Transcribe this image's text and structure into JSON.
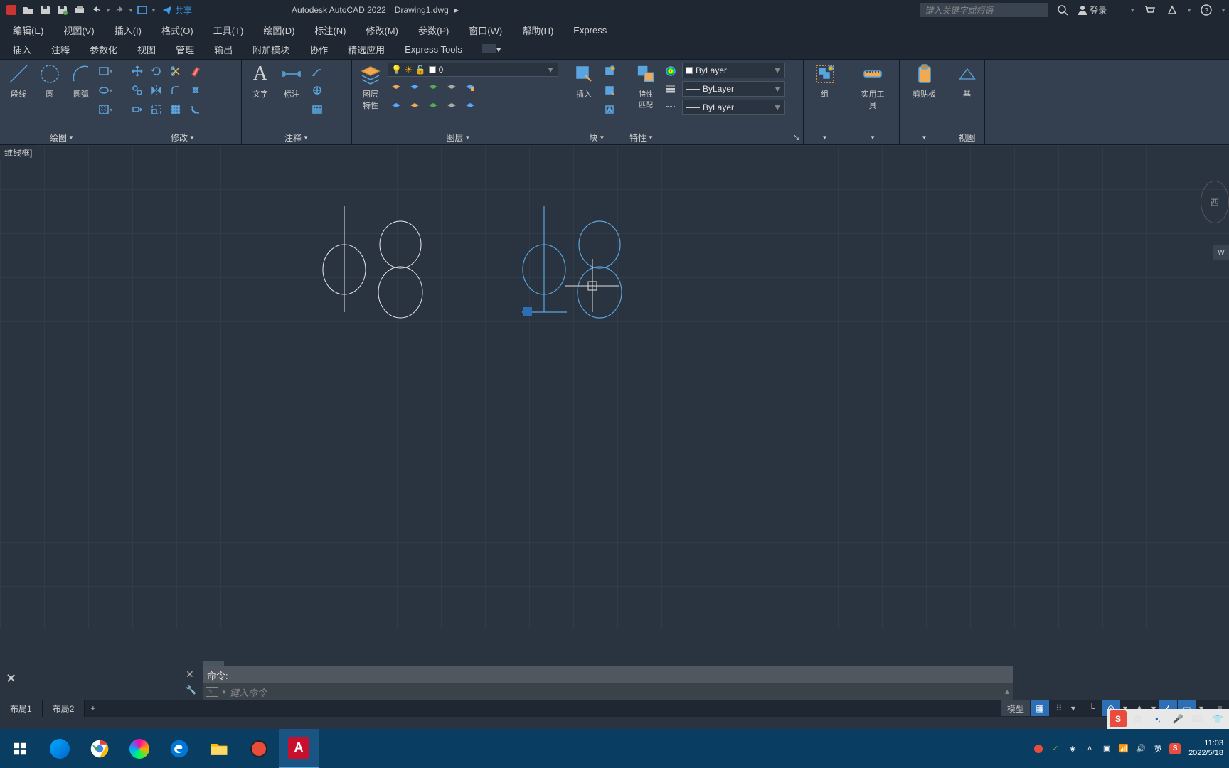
{
  "titlebar": {
    "app_name": "Autodesk AutoCAD 2022",
    "file_name": "Drawing1.dwg",
    "share_label": "共享",
    "search_placeholder": "键入关键字或短语",
    "login_label": "登录"
  },
  "menubar": {
    "items": [
      "编辑(E)",
      "视图(V)",
      "插入(I)",
      "格式(O)",
      "工具(T)",
      "绘图(D)",
      "标注(N)",
      "修改(M)",
      "参数(P)",
      "窗口(W)",
      "帮助(H)",
      "Express"
    ]
  },
  "ribbon_tabs": [
    "插入",
    "注释",
    "参数化",
    "视图",
    "管理",
    "输出",
    "附加模块",
    "协作",
    "精选应用",
    "Express Tools"
  ],
  "panels": {
    "draw": {
      "title": "绘图",
      "tools": {
        "line": "段线",
        "circle": "圆",
        "arc": "圆弧"
      }
    },
    "modify": {
      "title": "修改"
    },
    "annotation": {
      "title": "注释",
      "tools": {
        "text": "文字",
        "dim": "标注"
      }
    },
    "layers": {
      "title": "图层",
      "props_label": "图层\n特性",
      "current_layer": "0"
    },
    "block": {
      "title": "块",
      "insert_label": "插入"
    },
    "properties": {
      "title": "特性",
      "match_label": "特性\n匹配",
      "color": "ByLayer",
      "lineweight": "ByLayer",
      "linetype": "ByLayer"
    },
    "groups": {
      "title": "组"
    },
    "utils": {
      "title": "实用工具"
    },
    "clipboard": {
      "title": "剪贴板"
    },
    "view": {
      "title": "视图",
      "base": "基"
    }
  },
  "canvas": {
    "view_label": "维线框]",
    "navcube": "西",
    "wcs": "W"
  },
  "commandline": {
    "history": "命令:",
    "placeholder": "键入命令"
  },
  "layout_tabs": [
    "布局1",
    "布局2"
  ],
  "statusbar": {
    "model": "模型"
  },
  "ime": {
    "lang": "英"
  },
  "taskbar": {
    "time": "11:03",
    "date": "2022/5/18",
    "lang": "英"
  }
}
